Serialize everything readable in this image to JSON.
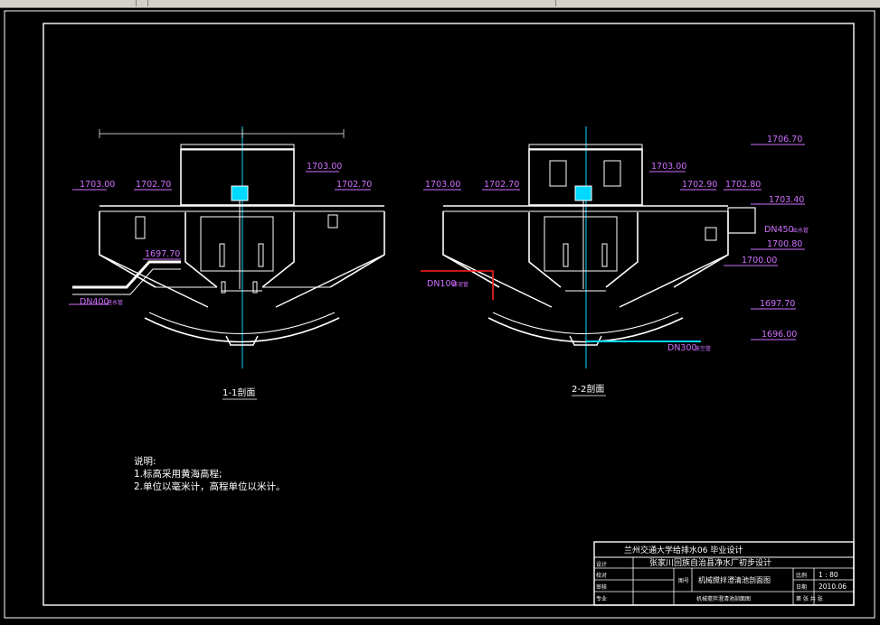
{
  "window": {
    "chrome_color": "#d4d0c8"
  },
  "colors": {
    "background": "#000000",
    "line_white": "#ffffff",
    "dimension_magenta": "#d070ff",
    "axis_cyan": "#00d8ff",
    "pipe_red": "#ff2020",
    "label_yellow": "#e8e800"
  },
  "section_1": {
    "title": "1-1剖面",
    "elevations": [
      "1703.00",
      "1702.70",
      "1703.00",
      "1702.70",
      "1697.70"
    ],
    "pipe_label": "DN400",
    "pipe_note": "进水管"
  },
  "section_2": {
    "title": "2-2剖面",
    "elevations": [
      "1703.00",
      "1702.70",
      "1703.00",
      "1702.90",
      "1702.80"
    ],
    "right_levels": [
      "1706.70",
      "1703.40",
      "1700.80",
      "1700.00",
      "1697.70",
      "1696.00"
    ],
    "pipe_labels": [
      "DN450",
      "DN100",
      "DN300"
    ],
    "pipe_notes": [
      "出水管",
      "排泥管",
      "放空管"
    ]
  },
  "notes": {
    "heading": "说明:",
    "lines": [
      "1.标高采用黄海高程;",
      "2.单位以毫米计，高程单位以米计。"
    ]
  },
  "title_block": {
    "school": "兰州交通大学给排水06 毕业设计",
    "project": "张家川回族自治县净水厂初步设计",
    "drawing_name": "机械搅拌澄清池剖面图",
    "row_labels": [
      "设计",
      "校对",
      "审核",
      "专业"
    ],
    "scale_label": "比例",
    "scale": "1 : 80",
    "date_label": "日期",
    "date": "2010.06",
    "sheet_label": "图号",
    "sheet_info": "第 张  共 张"
  }
}
